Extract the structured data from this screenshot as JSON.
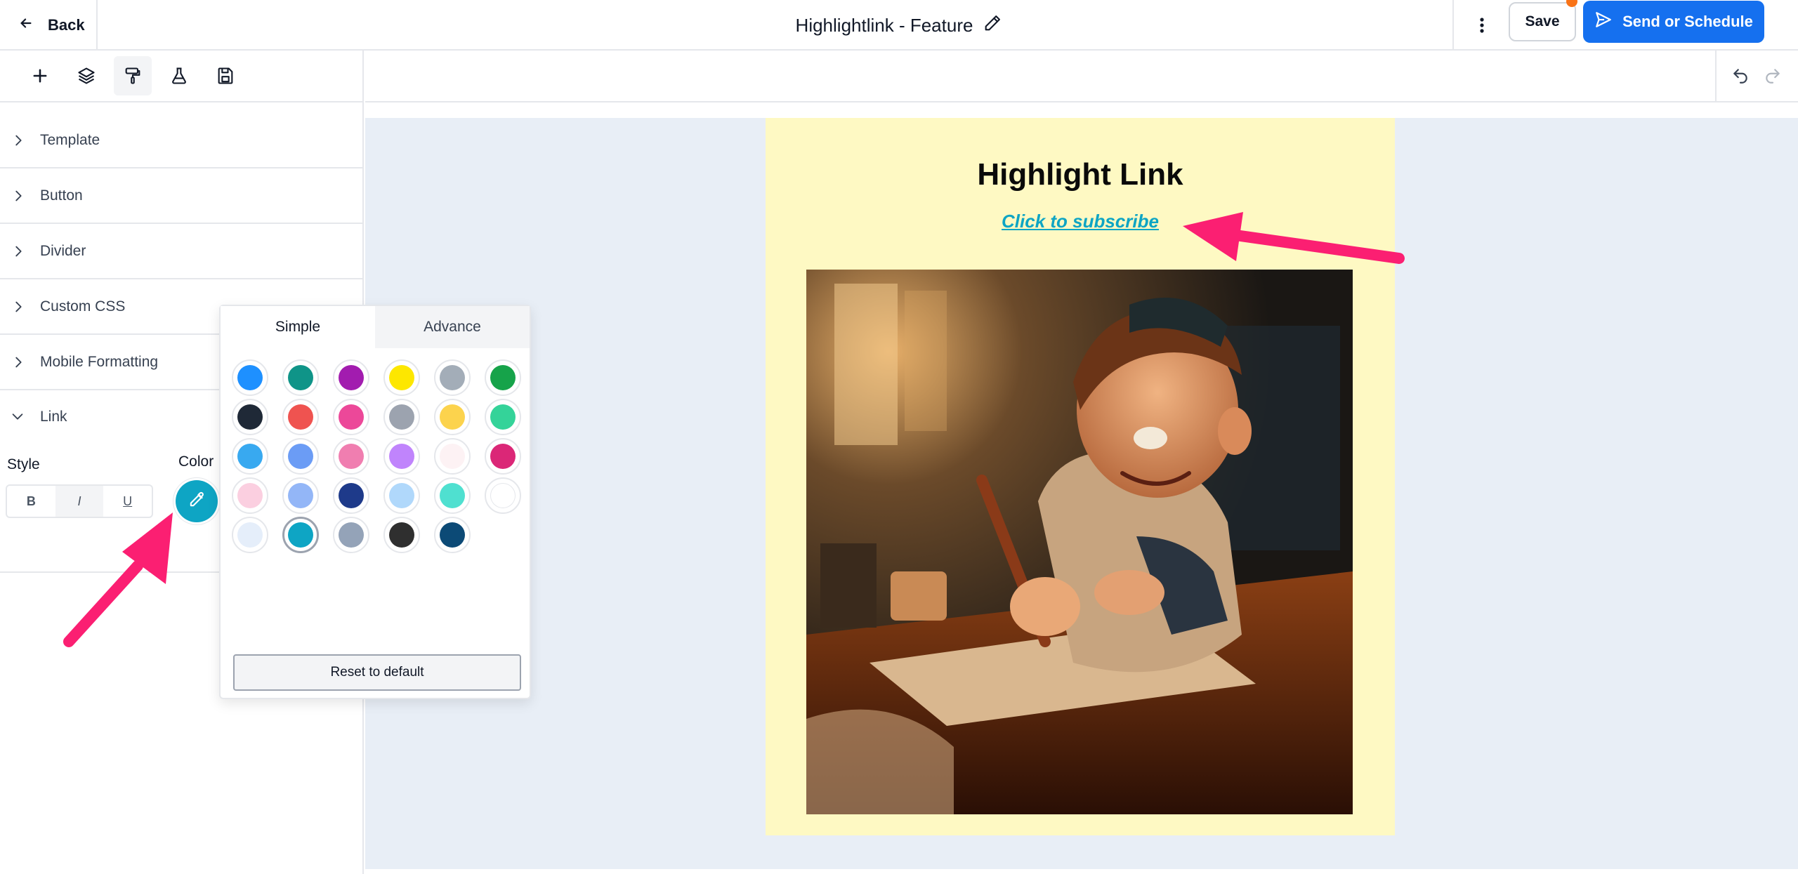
{
  "topbar": {
    "back_label": "Back",
    "title": "Highlightlink - Feature",
    "save_label": "Save",
    "send_label": "Send or Schedule"
  },
  "sidebar": {
    "sections": [
      {
        "label": "Template"
      },
      {
        "label": "Button"
      },
      {
        "label": "Divider"
      },
      {
        "label": "Custom CSS"
      },
      {
        "label": "Mobile Formatting"
      }
    ],
    "link": {
      "label": "Link",
      "style_label": "Style",
      "color_label": "Color",
      "style_buttons": [
        "B",
        "I",
        "U"
      ],
      "current_color": "#0ea5c4"
    }
  },
  "picker": {
    "tabs": [
      "Simple",
      "Advance"
    ],
    "active_tab": "Simple",
    "reset_label": "Reset to default",
    "swatches": [
      [
        "#1e90ff",
        "#0f9488",
        "#a21caf",
        "#fde700",
        "#a3adb8",
        "#16a34a"
      ],
      [
        "#1f2937",
        "#ef5350",
        "#ec4899",
        "#9ca3af",
        "#fcd34d",
        "#34d399"
      ],
      [
        "#38a9f0",
        "#6b9cf5",
        "#f07eb0",
        "#c084fc",
        "#fdf2f4",
        "#db2777"
      ],
      [
        "#fbcfe0",
        "#93b6f7",
        "#1e3a8a",
        "#b0d8fb",
        "#4fe0d0",
        "#ffffff"
      ],
      [
        "#e5eefa",
        "#0ea5c4",
        "#94a3b8",
        "#2f2f2f",
        "#0c4a76"
      ]
    ],
    "selected": "#0ea5c4"
  },
  "email": {
    "title": "Highlight Link",
    "link_text": "Click to subscribe",
    "link_color": "#0ea5c4",
    "background": "#fef9c3"
  },
  "colors": {
    "accent": "#1570ef",
    "annotation_arrow": "#fb1f72",
    "notification": "#f97316",
    "canvas_bg": "#e8eef6"
  }
}
